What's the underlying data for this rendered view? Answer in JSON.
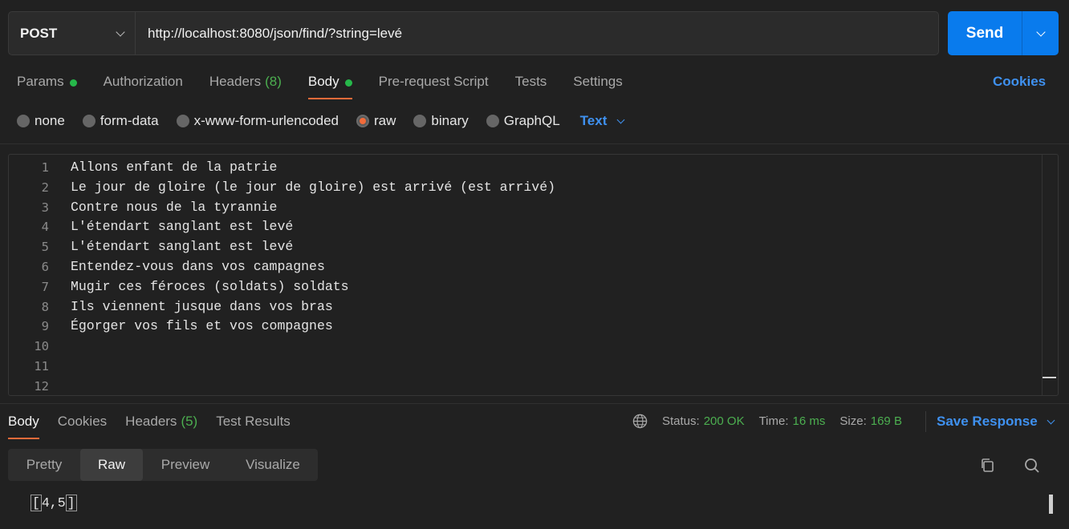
{
  "request": {
    "method": "POST",
    "url": "http://localhost:8080/json/find/?string=levé",
    "send_label": "Send"
  },
  "request_tabs": [
    {
      "label": "Params",
      "count": "",
      "dot": true
    },
    {
      "label": "Authorization",
      "count": "",
      "dot": false
    },
    {
      "label": "Headers",
      "count": "(8)",
      "dot": false
    },
    {
      "label": "Body",
      "count": "",
      "dot": true,
      "active": true
    },
    {
      "label": "Pre-request Script",
      "count": "",
      "dot": false
    },
    {
      "label": "Tests",
      "count": "",
      "dot": false
    },
    {
      "label": "Settings",
      "count": "",
      "dot": false
    }
  ],
  "cookies_label": "Cookies",
  "body_types": [
    {
      "label": "none",
      "checked": false
    },
    {
      "label": "form-data",
      "checked": false
    },
    {
      "label": "x-www-form-urlencoded",
      "checked": false
    },
    {
      "label": "raw",
      "checked": true
    },
    {
      "label": "binary",
      "checked": false
    },
    {
      "label": "GraphQL",
      "checked": false
    }
  ],
  "raw_format": "Text",
  "editor": {
    "line_numbers": [
      "1",
      "2",
      "3",
      "4",
      "5",
      "6",
      "7",
      "8",
      "9",
      "10",
      "11",
      "12"
    ],
    "lines": [
      "Allons enfant de la patrie",
      "Le jour de gloire (le jour de gloire) est arrivé (est arrivé)",
      "Contre nous de la tyrannie",
      "L'étendart sanglant est levé",
      "L'étendart sanglant est levé",
      "Entendez-vous dans vos campagnes",
      "Mugir ces féroces (soldats) soldats",
      "Ils viennent jusque dans vos bras",
      "Égorger vos fils et vos compagnes",
      "",
      "",
      ""
    ]
  },
  "response_tabs": [
    {
      "label": "Body",
      "count": "",
      "active": true
    },
    {
      "label": "Cookies",
      "count": ""
    },
    {
      "label": "Headers",
      "count": "(5)"
    },
    {
      "label": "Test Results",
      "count": ""
    }
  ],
  "response_meta": {
    "status_label": "Status:",
    "status_value": "200 OK",
    "time_label": "Time:",
    "time_value": "16 ms",
    "size_label": "Size:",
    "size_value": "169 B"
  },
  "save_response_label": "Save Response",
  "view_modes": [
    "Pretty",
    "Raw",
    "Preview",
    "Visualize"
  ],
  "active_view": "Raw",
  "response_body": {
    "open": "[",
    "content": "4,5",
    "close": "]"
  },
  "colors": {
    "accent": "#f26b3a",
    "primary": "#097bed",
    "link": "#3f91f0",
    "success": "#4caf50"
  }
}
